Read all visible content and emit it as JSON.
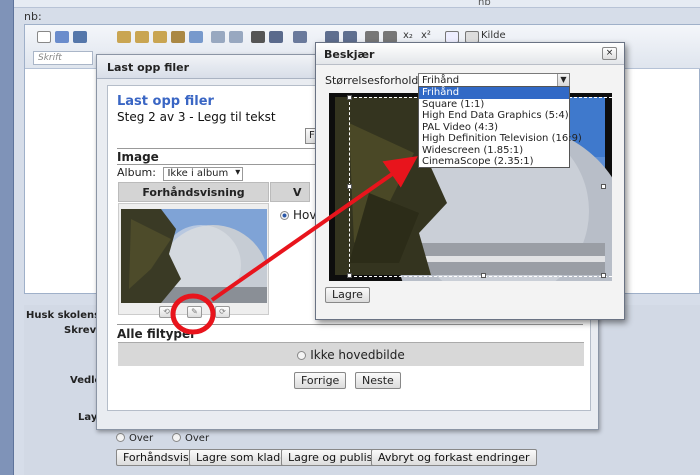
{
  "background": {
    "nb_top": "nb",
    "nb_label": "nb:",
    "toolbar": {
      "font_select": "Skrift",
      "subscript": "x₂",
      "superscript": "x²",
      "source_label": "Kilde"
    },
    "row_labels": {
      "husk": "Husk skolens reg",
      "skrevet": "Skrevet",
      "vedlegg": "Vedleg",
      "layout": "Layo"
    },
    "radio_row": {
      "option1": "Over",
      "option2": "Over"
    },
    "buttons": {
      "preview": "Forhåndsvis",
      "save_draft": "Lagre som kladd",
      "save_publish": "Lagre og publiser",
      "cancel": "Avbryt og forkast endringer"
    }
  },
  "upload_dialog": {
    "title": "Last opp filer",
    "heading": "Last opp filer",
    "subtitle": "Steg 2 av 3 - Legg til tekst",
    "partial_button": "F",
    "image_section": "Image",
    "album_label": "Album:",
    "album_value": "Ikke i album",
    "col_preview": "Forhåndsvisning",
    "col_right": "V",
    "main_image_option": "Hoved",
    "all_filetypes": "Alle filtyper",
    "not_main_image": "Ikke hovedbilde",
    "prev_button": "Forrige",
    "next_button": "Neste"
  },
  "crop_dialog": {
    "title": "Beskjær",
    "close_label": "×",
    "ratio_label": "Størrelsesforhold:",
    "ratio_value": "Frihånd",
    "save_button": "Lagre",
    "ratio_options": [
      "Frihånd",
      "Square (1:1)",
      "High End Data Graphics (5:4)",
      "PAL Video (4:3)",
      "High Definition Television (16:9)",
      "Widescreen (1.85:1)",
      "CinemaScope (2.35:1)"
    ],
    "selected_option_index": 0
  },
  "colors": {
    "heading_blue": "#3a66c4",
    "selection_blue": "#3169c6",
    "annotation_red": "#e8141c"
  }
}
